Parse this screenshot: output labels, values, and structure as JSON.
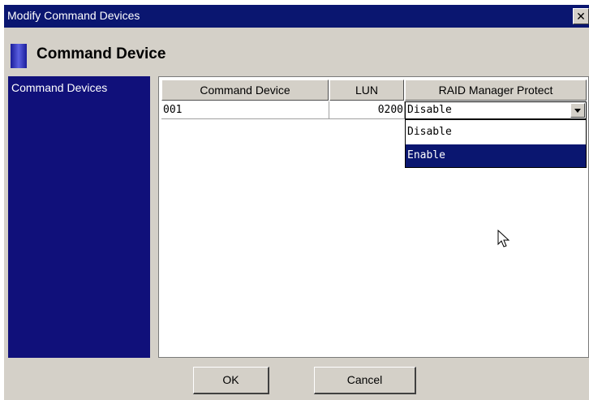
{
  "window": {
    "title": "Modify Command Devices",
    "close_glyph": "✕"
  },
  "header": {
    "title": "Command Device",
    "icon": "header-bar-icon"
  },
  "left_panel": {
    "label": "Command Devices"
  },
  "table": {
    "columns": [
      "Command Device",
      "LUN",
      "RAID Manager Protect"
    ],
    "rows": [
      {
        "command_device": "001",
        "lun": "0200",
        "raid_manager_protect": "Disable"
      }
    ]
  },
  "dropdown": {
    "options": [
      "Disable",
      "Enable"
    ],
    "highlighted": "Enable"
  },
  "buttons": {
    "ok": "OK",
    "cancel": "Cancel"
  },
  "colors": {
    "titlebar": "#0a1670",
    "panel": "#10107a",
    "dialog": "#d4d0c8"
  }
}
